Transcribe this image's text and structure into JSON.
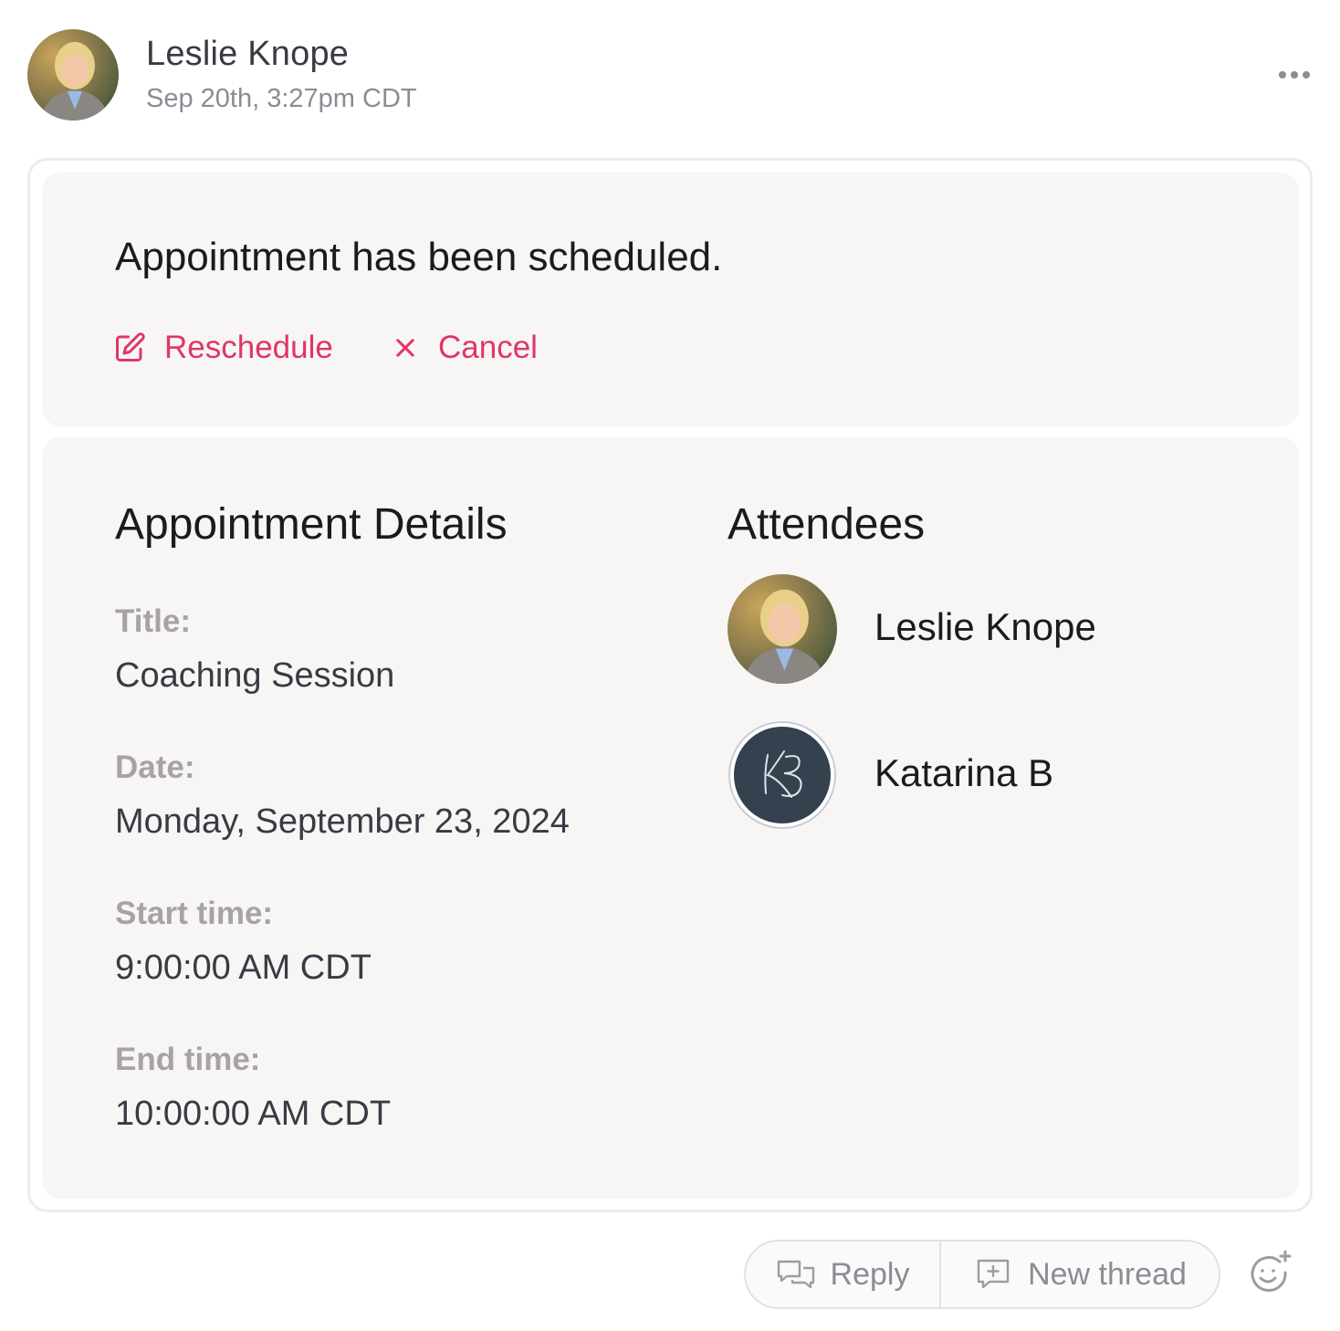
{
  "header": {
    "author_name": "Leslie Knope",
    "timestamp": "Sep 20th, 3:27pm CDT",
    "more_icon": "more-horizontal-icon"
  },
  "confirmation": {
    "message": "Appointment has been scheduled.",
    "reschedule_label": "Reschedule",
    "reschedule_icon": "edit-icon",
    "cancel_label": "Cancel",
    "cancel_icon": "close-icon",
    "accent_color": "#e0356a"
  },
  "details": {
    "heading": "Appointment Details",
    "fields": [
      {
        "label": "Title:",
        "value": "Coaching Session"
      },
      {
        "label": "Date:",
        "value": "Monday, September 23, 2024"
      },
      {
        "label": "Start time:",
        "value": "9:00:00 AM CDT"
      },
      {
        "label": "End time:",
        "value": "10:00:00 AM CDT"
      }
    ]
  },
  "attendees": {
    "heading": "Attendees",
    "list": [
      {
        "name": "Leslie Knope",
        "avatar": "photo-avatar"
      },
      {
        "name": "Katarina B",
        "avatar": "monogram-avatar",
        "monogram": "KB"
      }
    ]
  },
  "footer": {
    "reply_label": "Reply",
    "reply_icon": "chat-bubbles-icon",
    "new_thread_label": "New thread",
    "new_thread_icon": "new-thread-icon",
    "reaction_icon": "add-emoji-icon"
  }
}
